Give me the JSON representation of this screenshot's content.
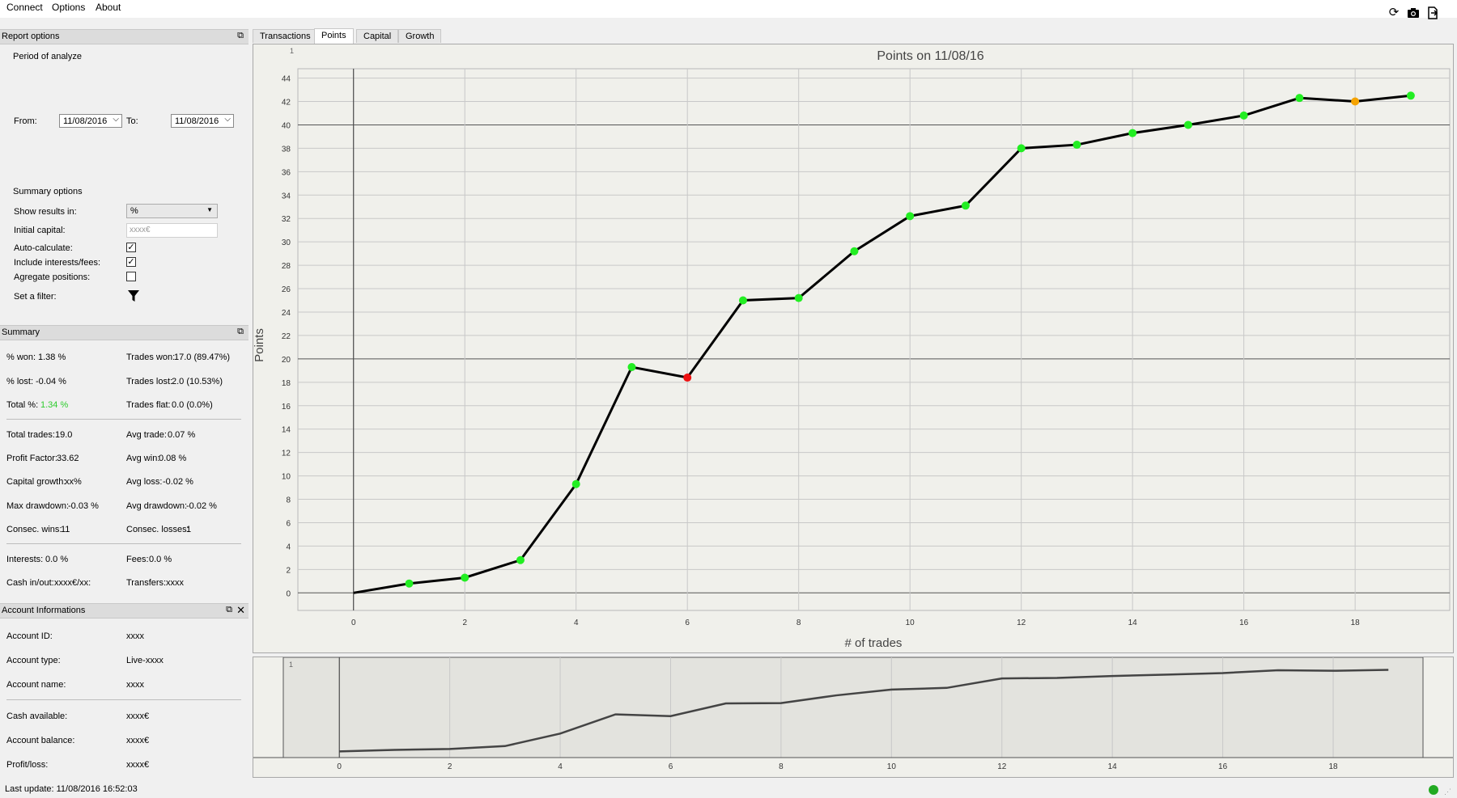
{
  "menu": {
    "connect": "Connect",
    "options": "Options",
    "about": "About"
  },
  "toolbar_icons": [
    "refresh-icon",
    "camera-icon",
    "export-icon"
  ],
  "report_options": {
    "title": "Report options",
    "period_label": "Period of analyze",
    "from_label": "From:",
    "from_value": "11/08/2016",
    "to_label": "To:",
    "to_value": "11/08/2016",
    "summary_options_label": "Summary options",
    "show_results_label": "Show results in:",
    "show_results_value": "%",
    "initial_capital_label": "Initial capital:",
    "initial_capital_placeholder": "xxxx€",
    "auto_calc_label": "Auto-calculate:",
    "auto_calc_checked": true,
    "include_fees_label": "Include interests/fees:",
    "include_fees_checked": true,
    "aggregate_label": "Agregate positions:",
    "aggregate_checked": false,
    "filter_label": "Set a filter:"
  },
  "summary": {
    "title": "Summary",
    "pct_won_label": "% won:",
    "pct_won": "1.38 %",
    "trades_won_label": "Trades won:",
    "trades_won": "17.0 (89.47%)",
    "pct_lost_label": "% lost:",
    "pct_lost": "-0.04 %",
    "trades_lost_label": "Trades lost:",
    "trades_lost": "2.0 (10.53%)",
    "total_pct_label": "Total %:",
    "total_pct": "1.34 %",
    "trades_flat_label": "Trades flat:",
    "trades_flat": "0.0 (0.0%)",
    "total_trades_label": "Total trades:",
    "total_trades": "19.0",
    "avg_trade_label": "Avg trade:",
    "avg_trade": "0.07 %",
    "profit_factor_label": "Profit Factor:",
    "profit_factor": "33.62",
    "avg_win_label": "Avg win:",
    "avg_win": "0.08 %",
    "capital_growth_label": "Capital growth:",
    "capital_growth": "xx%",
    "avg_loss_label": "Avg loss:",
    "avg_loss": "-0.02 %",
    "max_dd_label": "Max drawdown:",
    "max_dd": "-0.03 %",
    "avg_dd_label": "Avg drawdown:",
    "avg_dd": "-0.02 %",
    "consec_wins_label": "Consec. wins:",
    "consec_wins": "11",
    "consec_losses_label": "Consec. losses:",
    "consec_losses": "1",
    "interests_label": "Interests:",
    "interests": "0.0 %",
    "fees_label": "Fees:",
    "fees": "0.0 %",
    "cash_io_label": "Cash in/out:",
    "cash_io": "xxxx€/xx:",
    "transfers_label": "Transfers:",
    "transfers": "xxxx",
    "total_color": "#2ecc2e"
  },
  "account": {
    "title": "Account Informations",
    "id_label": "Account ID:",
    "id": "xxxx",
    "type_label": "Account type:",
    "type": "Live-xxxx",
    "name_label": "Account name:",
    "name": "xxxx",
    "cash_label": "Cash available:",
    "cash": "xxxx€",
    "balance_label": "Account balance:",
    "balance": "xxxx€",
    "pl_label": "Profit/loss:",
    "pl": "xxxx€"
  },
  "tabs": [
    "Transactions",
    "Points",
    "Capital",
    "Growth"
  ],
  "active_tab": "Points",
  "status": {
    "last_update": "Last update: 11/08/2016 16:52:03",
    "indicator_color": "#22aa22"
  },
  "chart_data": {
    "type": "line",
    "title": "Points on 11/08/16",
    "xlabel": "# of trades",
    "ylabel": "Points",
    "corner_label": "1",
    "x": [
      0,
      1,
      2,
      3,
      4,
      5,
      6,
      7,
      8,
      9,
      10,
      11,
      12,
      13,
      14,
      15,
      16,
      17,
      18,
      19
    ],
    "values": [
      0,
      0.8,
      1.3,
      2.8,
      9.3,
      19.3,
      18.4,
      25.0,
      25.2,
      29.2,
      32.2,
      33.1,
      38.0,
      38.3,
      39.3,
      40.0,
      40.8,
      42.3,
      42.0,
      42.5
    ],
    "point_status": [
      "none",
      "win",
      "win",
      "win",
      "win",
      "win",
      "loss",
      "win",
      "win",
      "win",
      "win",
      "win",
      "win",
      "win",
      "win",
      "win",
      "win",
      "win",
      "neutral",
      "win"
    ],
    "colors": {
      "win": "#22ee22",
      "loss": "#ee1111",
      "neutral": "#f5a300",
      "line": "#000000"
    },
    "xlim": [
      -1,
      19.7
    ],
    "ylim": [
      -1.5,
      44.8
    ],
    "xticks": [
      0,
      2,
      4,
      6,
      8,
      10,
      12,
      14,
      16,
      18
    ],
    "yticks": [
      0,
      2,
      4,
      6,
      8,
      10,
      12,
      14,
      16,
      18,
      20,
      22,
      24,
      26,
      28,
      30,
      32,
      34,
      36,
      38,
      40,
      42,
      44
    ],
    "major_lines": [
      0,
      20,
      40
    ],
    "grid": true,
    "navigator_label": "1"
  }
}
